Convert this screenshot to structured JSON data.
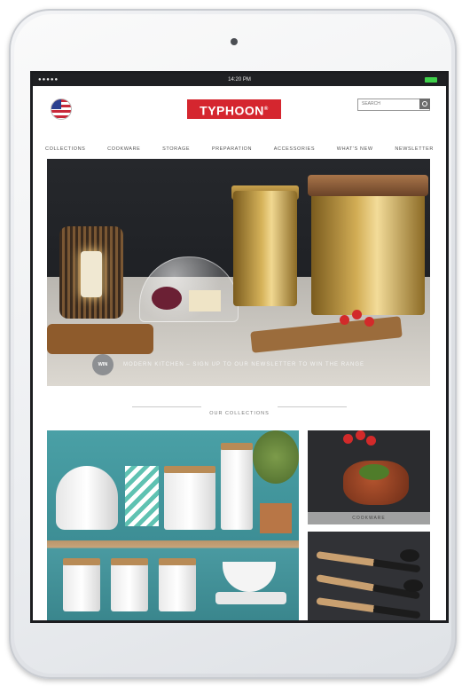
{
  "status_bar": {
    "signal": "●●●●●",
    "time": "14:20 PM"
  },
  "header": {
    "logo_text": "TYPHOON",
    "logo_mark": "®",
    "search_placeholder": "SEARCH",
    "flag_icon": "us-flag-icon",
    "search_icon": "search-icon"
  },
  "nav": {
    "items": [
      "COLLECTIONS",
      "COOKWARE",
      "STORAGE",
      "PREPARATION",
      "ACCESSORIES",
      "WHAT'S NEW",
      "NEWSLETTER"
    ]
  },
  "hero": {
    "badge": "WIN",
    "caption": "MODERN KITCHEN – SIGN UP TO OUR NEWSLETTER TO WIN THE RANGE"
  },
  "collections": {
    "title": "OUR COLLECTIONS",
    "tiles": [
      {
        "label": ""
      },
      {
        "label": "COOKWARE"
      },
      {
        "label": ""
      }
    ]
  },
  "colors": {
    "brand_red": "#d5262f",
    "battery": "#3ecf4a",
    "statusbar": "#1f2023"
  }
}
